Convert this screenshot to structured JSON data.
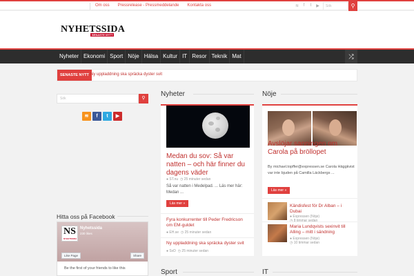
{
  "topbar": {
    "links": [
      "Om oss",
      "Pressrelease - Pressmeddelande",
      "Kontakta oss"
    ],
    "social_icons": [
      "rss-icon",
      "facebook-icon",
      "twitter-icon",
      "youtube-icon"
    ],
    "search_placeholder": "Sök"
  },
  "logo": {
    "name": "NYHETSSIDA",
    "tagline": "SENASTE NYTT"
  },
  "nav": {
    "items": [
      "Nyheter",
      "Ekonomi",
      "Sport",
      "Nöje",
      "Hälsa",
      "Kultur",
      "IT",
      "Resor",
      "Teknik",
      "Mat"
    ],
    "shuffle_icon": "shuffle-icon"
  },
  "breaking": {
    "label": "SENASTE NYTT",
    "text": "Ny uppladdning ska spräcka dyster svit"
  },
  "sidebar": {
    "search_placeholder": "Sök",
    "facebook_title": "Hitta oss på Facebook",
    "fb_widget": {
      "page_name": "Nyhetssida",
      "likes": "230 likes",
      "logo_text": "NS",
      "logo_sub": "NYHETSSIDA",
      "like_button": "Like Page",
      "share_button": "Share",
      "friends_text": "Be the first of your friends to like this"
    }
  },
  "sections": {
    "nyheter": {
      "title": "Nyheter",
      "main": {
        "title": "Medan du sov: Så var natten – och här finner du dagens väder",
        "source": "ST.nu",
        "time": "25 minuter sedan",
        "excerpt": "Så var natten i Medelpad. ... Läs mer här: Medan ...",
        "more": "Läs mer »"
      },
      "list": [
        {
          "title": "Fyra konkurrenter till Peder Fredricson om EM-guldet",
          "source": "EH.se",
          "time": "25 minuter sedan"
        },
        {
          "title": "Ny uppladdning ska spräcka dyster svit",
          "source": "SvD",
          "time": "25 minuter sedan"
        }
      ]
    },
    "noje": {
      "title": "Nöje",
      "main": {
        "title": "Avslöjar sanningen om Carola på bröllopet",
        "excerpt": "By michael.topffer@expressen.se Carola Häggkvist var inte bjuden på Camilla Läckbergs ...",
        "source": "Expressen (Nöje)",
        "more": "Läs mer »"
      },
      "list": [
        {
          "title": "Kändisfest för Dr Alban – i Dubai",
          "source": "Expressen (Nöje)",
          "time": "8 timmar sedan"
        },
        {
          "title": "Maria Lundqvists sexinvit till Alling – mitt i sändning",
          "source": "Expressen (Nöje)",
          "time": "10 timmar sedan"
        }
      ]
    },
    "sport": {
      "title": "Sport"
    },
    "it": {
      "title": "IT"
    }
  },
  "colors": {
    "accent": "#e0403e",
    "nav_bg": "#2d2d2d",
    "page_bg": "#f2f2f2"
  }
}
